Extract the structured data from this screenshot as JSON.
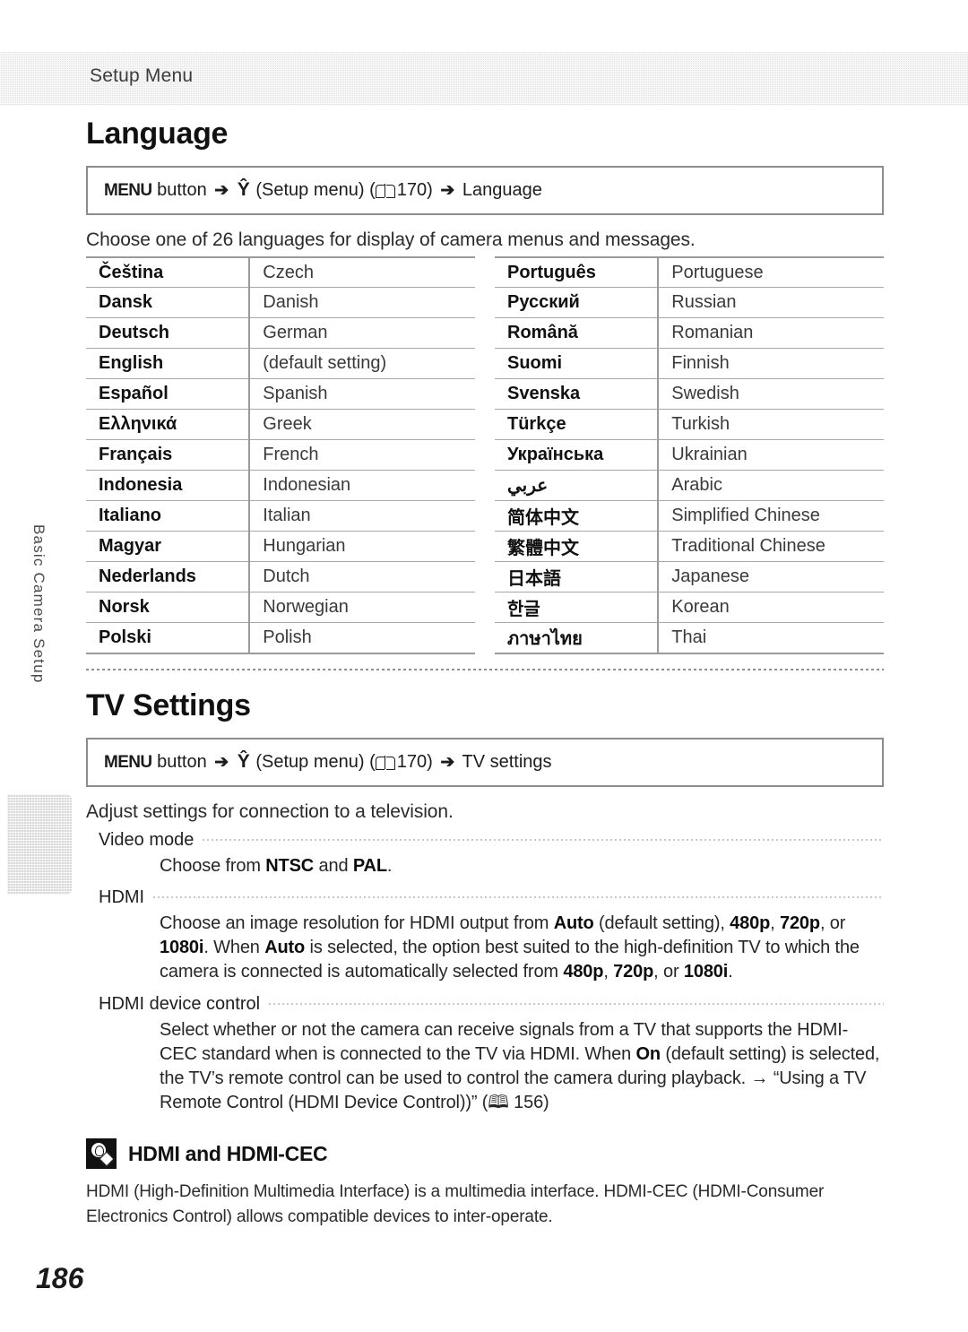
{
  "running_header": {
    "title": "Setup Menu"
  },
  "side_tab": {
    "label": "Basic Camera Setup"
  },
  "folio": {
    "page_number": "186"
  },
  "language_section": {
    "heading": "Language",
    "menu_path": {
      "menu_button": "MENU",
      "button_word": "button",
      "arrow": "➔",
      "wrench_icon": "Ŷ",
      "setup_menu": "(Setup menu)",
      "page_ref": "170",
      "destination": "Language"
    },
    "intro": "Choose one of 26 languages for display of camera menus and messages.",
    "table_left": [
      {
        "native": "Čeština",
        "english": "Czech"
      },
      {
        "native": "Dansk",
        "english": "Danish"
      },
      {
        "native": "Deutsch",
        "english": "German"
      },
      {
        "native": "English",
        "english": "(default setting)"
      },
      {
        "native": "Español",
        "english": "Spanish"
      },
      {
        "native": "Ελληνικά",
        "english": "Greek"
      },
      {
        "native": "Français",
        "english": "French"
      },
      {
        "native": "Indonesia",
        "english": "Indonesian"
      },
      {
        "native": "Italiano",
        "english": "Italian"
      },
      {
        "native": "Magyar",
        "english": "Hungarian"
      },
      {
        "native": "Nederlands",
        "english": "Dutch"
      },
      {
        "native": "Norsk",
        "english": "Norwegian"
      },
      {
        "native": "Polski",
        "english": "Polish"
      }
    ],
    "table_right": [
      {
        "native": "Português",
        "english": "Portuguese"
      },
      {
        "native": "Русский",
        "english": "Russian"
      },
      {
        "native": "Română",
        "english": "Romanian"
      },
      {
        "native": "Suomi",
        "english": "Finnish"
      },
      {
        "native": "Svenska",
        "english": "Swedish"
      },
      {
        "native": "Türkçe",
        "english": "Turkish"
      },
      {
        "native": "Українська",
        "english": "Ukrainian"
      },
      {
        "native": "عربي",
        "english": "Arabic"
      },
      {
        "native": "简体中文",
        "english": "Simplified Chinese"
      },
      {
        "native": "繁體中文",
        "english": "Traditional Chinese"
      },
      {
        "native": "日本語",
        "english": "Japanese"
      },
      {
        "native": "한글",
        "english": "Korean"
      },
      {
        "native": "ภาษาไทย",
        "english": "Thai"
      }
    ]
  },
  "tv_section": {
    "heading": "TV Settings",
    "menu_path": {
      "menu_button": "MENU",
      "button_word": "button",
      "arrow": "➔",
      "wrench_icon": "Ŷ",
      "setup_menu": "(Setup menu)",
      "page_ref": "170",
      "destination": "TV settings"
    },
    "intro": "Adjust settings for connection to a television.",
    "items": [
      {
        "label": "Video mode",
        "body_html": "Choose from <b>NTSC</b> and <b>PAL</b>."
      },
      {
        "label": "HDMI",
        "body_html": "Choose an image resolution for HDMI output from <b>Auto</b> (default setting), <b>480p</b>, <b>720p</b>, or <b>1080i</b>. When <b>Auto</b> is selected, the option best suited to the high-definition TV to which the camera is connected is automatically selected from <b>480p</b>, <b>720p</b>, or <b>1080i</b>."
      },
      {
        "label": "HDMI device control",
        "body_html": "Select whether or not the camera can receive signals from a TV that supports the HDMI-CEC standard when is connected to the TV via HDMI. When <b>On</b> (default setting) is selected, the TV’s remote control can be used to control the camera during playback. → “Using a TV Remote Control (HDMI Device Control))” (&#x1F56E; 156)"
      }
    ]
  },
  "note": {
    "title": "HDMI and HDMI-CEC",
    "text": "HDMI (High-Definition Multimedia Interface) is a multimedia interface. HDMI-CEC (HDMI-Consumer Electronics Control) allows compatible devices to inter-operate."
  }
}
